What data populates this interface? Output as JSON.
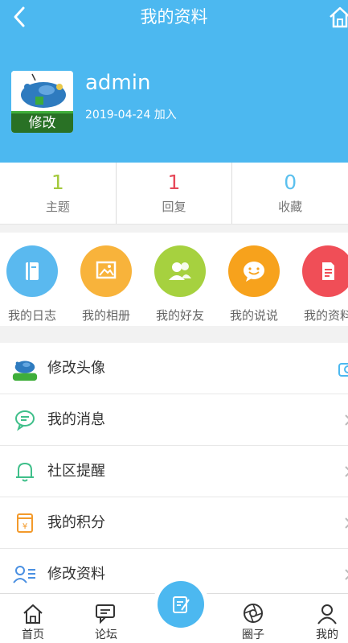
{
  "header": {
    "title": "我的资料",
    "color": "#4cb8f0",
    "back_icon": "chevron-left-icon",
    "home_icon": "home-icon"
  },
  "profile": {
    "username": "admin",
    "joined": "2019-04-24 加入",
    "avatar_edit_label": "修改"
  },
  "stats": [
    {
      "num": "1",
      "label": "主题",
      "color": "#a4c93c"
    },
    {
      "num": "1",
      "label": "回复",
      "color": "#e6495a"
    },
    {
      "num": "0",
      "label": "收藏",
      "color": "#5bc0ee"
    }
  ],
  "quick_links": [
    {
      "label": "我的日志",
      "color": "#5ab9ef",
      "icon": "notebook-icon"
    },
    {
      "label": "我的相册",
      "color": "#f8b33b",
      "icon": "photo-icon"
    },
    {
      "label": "我的好友",
      "color": "#a6d13f",
      "icon": "friends-icon"
    },
    {
      "label": "我的说说",
      "color": "#f7a21c",
      "icon": "smile-chat-icon"
    },
    {
      "label": "我的资料",
      "color": "#f04e57",
      "icon": "document-icon"
    }
  ],
  "menu": [
    {
      "label": "修改头像",
      "icon": "avatar-thumb"
    },
    {
      "label": "我的消息",
      "icon": "message-icon"
    },
    {
      "label": "社区提醒",
      "icon": "bell-icon"
    },
    {
      "label": "我的积分",
      "icon": "points-icon"
    },
    {
      "label": "修改资料",
      "icon": "profile-card-icon"
    }
  ],
  "tabbar": [
    {
      "label": "首页",
      "icon": "home-icon"
    },
    {
      "label": "论坛",
      "icon": "forum-icon"
    },
    {
      "label": "圈子",
      "icon": "aperture-icon"
    },
    {
      "label": "我的",
      "icon": "user-icon"
    }
  ],
  "post_button_icon": "edit-icon"
}
